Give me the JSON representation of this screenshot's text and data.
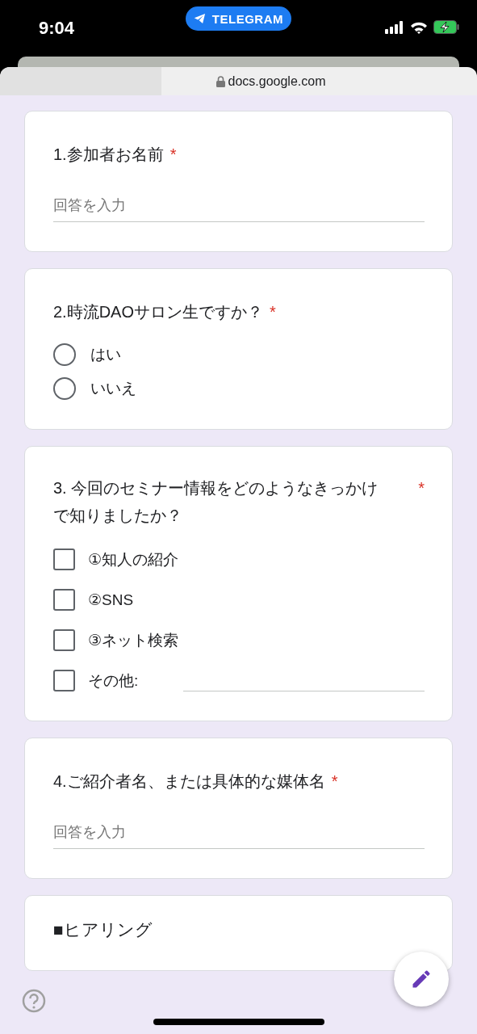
{
  "status_bar": {
    "time": "9:04",
    "app_pill": "TELEGRAM"
  },
  "browser": {
    "url": "docs.google.com"
  },
  "questions": [
    {
      "kind": "text",
      "title": "1.参加者お名前",
      "required_mark": "*",
      "placeholder": "回答を入力"
    },
    {
      "kind": "radio",
      "title": "2.時流DAOサロン生ですか？",
      "required_mark": "*",
      "options": [
        {
          "label": "はい",
          "selected": false
        },
        {
          "label": "いいえ",
          "selected": false
        }
      ]
    },
    {
      "kind": "checkbox",
      "title": "3.  今回のセミナー情報をどのようなきっかけで知りましたか？",
      "required_mark": "*",
      "options": [
        {
          "kind": "plain",
          "label": "①知人の紹介",
          "checked": false
        },
        {
          "kind": "plain",
          "label": "②SNS",
          "checked": false
        },
        {
          "kind": "plain",
          "label": "③ネット検索",
          "checked": false
        },
        {
          "kind": "other",
          "label": "その他:",
          "checked": false
        }
      ]
    },
    {
      "kind": "text",
      "title": "4.ご紹介者名、または具体的な媒体名",
      "required_mark": "*",
      "placeholder": "回答を入力"
    },
    {
      "kind": "section",
      "title": "■ヒアリング"
    }
  ]
}
